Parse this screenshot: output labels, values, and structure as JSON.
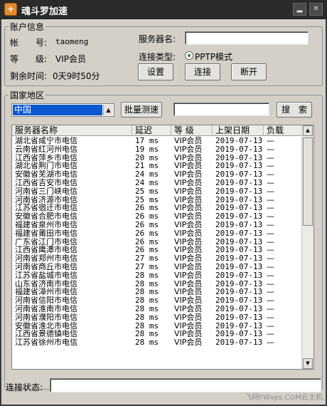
{
  "window": {
    "title": "魂斗罗加速",
    "minimize_glyph": "▂",
    "close_glyph": "✕"
  },
  "account": {
    "legend": "账户信息",
    "account_label": "帐　　号:",
    "account_value": "taomeng",
    "level_label": "等　　级:",
    "level_value": "VIP会员",
    "time_label": "剩余时间:",
    "time_value": "0天9时50分",
    "server_label": "服务器名:",
    "server_value": "",
    "conn_type_label": "连接类型:",
    "conn_type_option": "PPTP模式",
    "settings_button": "设置",
    "connect_button": "连接",
    "disconnect_button": "断开"
  },
  "region": {
    "legend": "国家地区",
    "selected_country": "中国",
    "batch_test_button": "批量测速",
    "search_value": "",
    "search_button": "搜　索"
  },
  "table": {
    "columns": [
      "服务器名称",
      "延迟",
      "等 级",
      "上架日期",
      "负载"
    ],
    "rows": [
      [
        "湖北省咸宁市电信",
        "17 ms",
        "VIP会员",
        "2019-07-13",
        "—"
      ],
      [
        "云南省红河州电信",
        "19 ms",
        "VIP会员",
        "2019-07-13",
        "—"
      ],
      [
        "江西省萍乡市电信",
        "20 ms",
        "VIP会员",
        "2019-07-13",
        "—"
      ],
      [
        "湖北省荆门市电信",
        "21 ms",
        "VIP会员",
        "2019-07-13",
        "—"
      ],
      [
        "安徽省芜湖市电信",
        "24 ms",
        "VIP会员",
        "2019-07-13",
        "—"
      ],
      [
        "江西省吉安市电信",
        "24 ms",
        "VIP会员",
        "2019-07-13",
        "—"
      ],
      [
        "河南省三门峡电信",
        "25 ms",
        "VIP会员",
        "2019-07-13",
        "—"
      ],
      [
        "河南省济源市电信",
        "25 ms",
        "VIP会员",
        "2019-07-13",
        "—"
      ],
      [
        "江苏省宿迁市电信",
        "26 ms",
        "VIP会员",
        "2019-07-13",
        "—"
      ],
      [
        "安徽省合肥市电信",
        "26 ms",
        "VIP会员",
        "2019-07-13",
        "—"
      ],
      [
        "福建省泉州市电信",
        "26 ms",
        "VIP会员",
        "2019-07-13",
        "—"
      ],
      [
        "福建省莆田市电信",
        "26 ms",
        "VIP会员",
        "2019-07-13",
        "—"
      ],
      [
        "广东省江门市电信",
        "26 ms",
        "VIP会员",
        "2019-07-13",
        "—"
      ],
      [
        "江西省鹰潭市电信",
        "26 ms",
        "VIP会员",
        "2019-07-13",
        "—"
      ],
      [
        "河南省郑州市电信",
        "27 ms",
        "VIP会员",
        "2019-07-13",
        "—"
      ],
      [
        "河南省商丘市电信",
        "27 ms",
        "VIP会员",
        "2019-07-13",
        "—"
      ],
      [
        "江苏省盐城市电信",
        "28 ms",
        "VIP会员",
        "2019-07-13",
        "—"
      ],
      [
        "山东省济南市电信",
        "28 ms",
        "VIP会员",
        "2019-07-13",
        "—"
      ],
      [
        "福建省漳州市电信",
        "28 ms",
        "VIP会员",
        "2019-07-13",
        "—"
      ],
      [
        "河南省信阳市电信",
        "28 ms",
        "VIP会员",
        "2019-07-13",
        "—"
      ],
      [
        "河南省淮南市电信",
        "28 ms",
        "VIP会员",
        "2019-07-13",
        "—"
      ],
      [
        "河南省濮阳市电信",
        "28 ms",
        "VIP会员",
        "2019-07-13",
        "—"
      ],
      [
        "安徽省淮北市电信",
        "28 ms",
        "VIP会员",
        "2019-07-13",
        "—"
      ],
      [
        "江西省景德镇电信",
        "28 ms",
        "VIP会员",
        "2019-07-13",
        "—"
      ],
      [
        "江苏省徐州市电信",
        "28 ms",
        "VIP会员",
        "2019-07-13",
        "—"
      ]
    ]
  },
  "status": {
    "label": "连接状态:",
    "value": ""
  },
  "watermark": "飞网FWvps.COM云主机"
}
